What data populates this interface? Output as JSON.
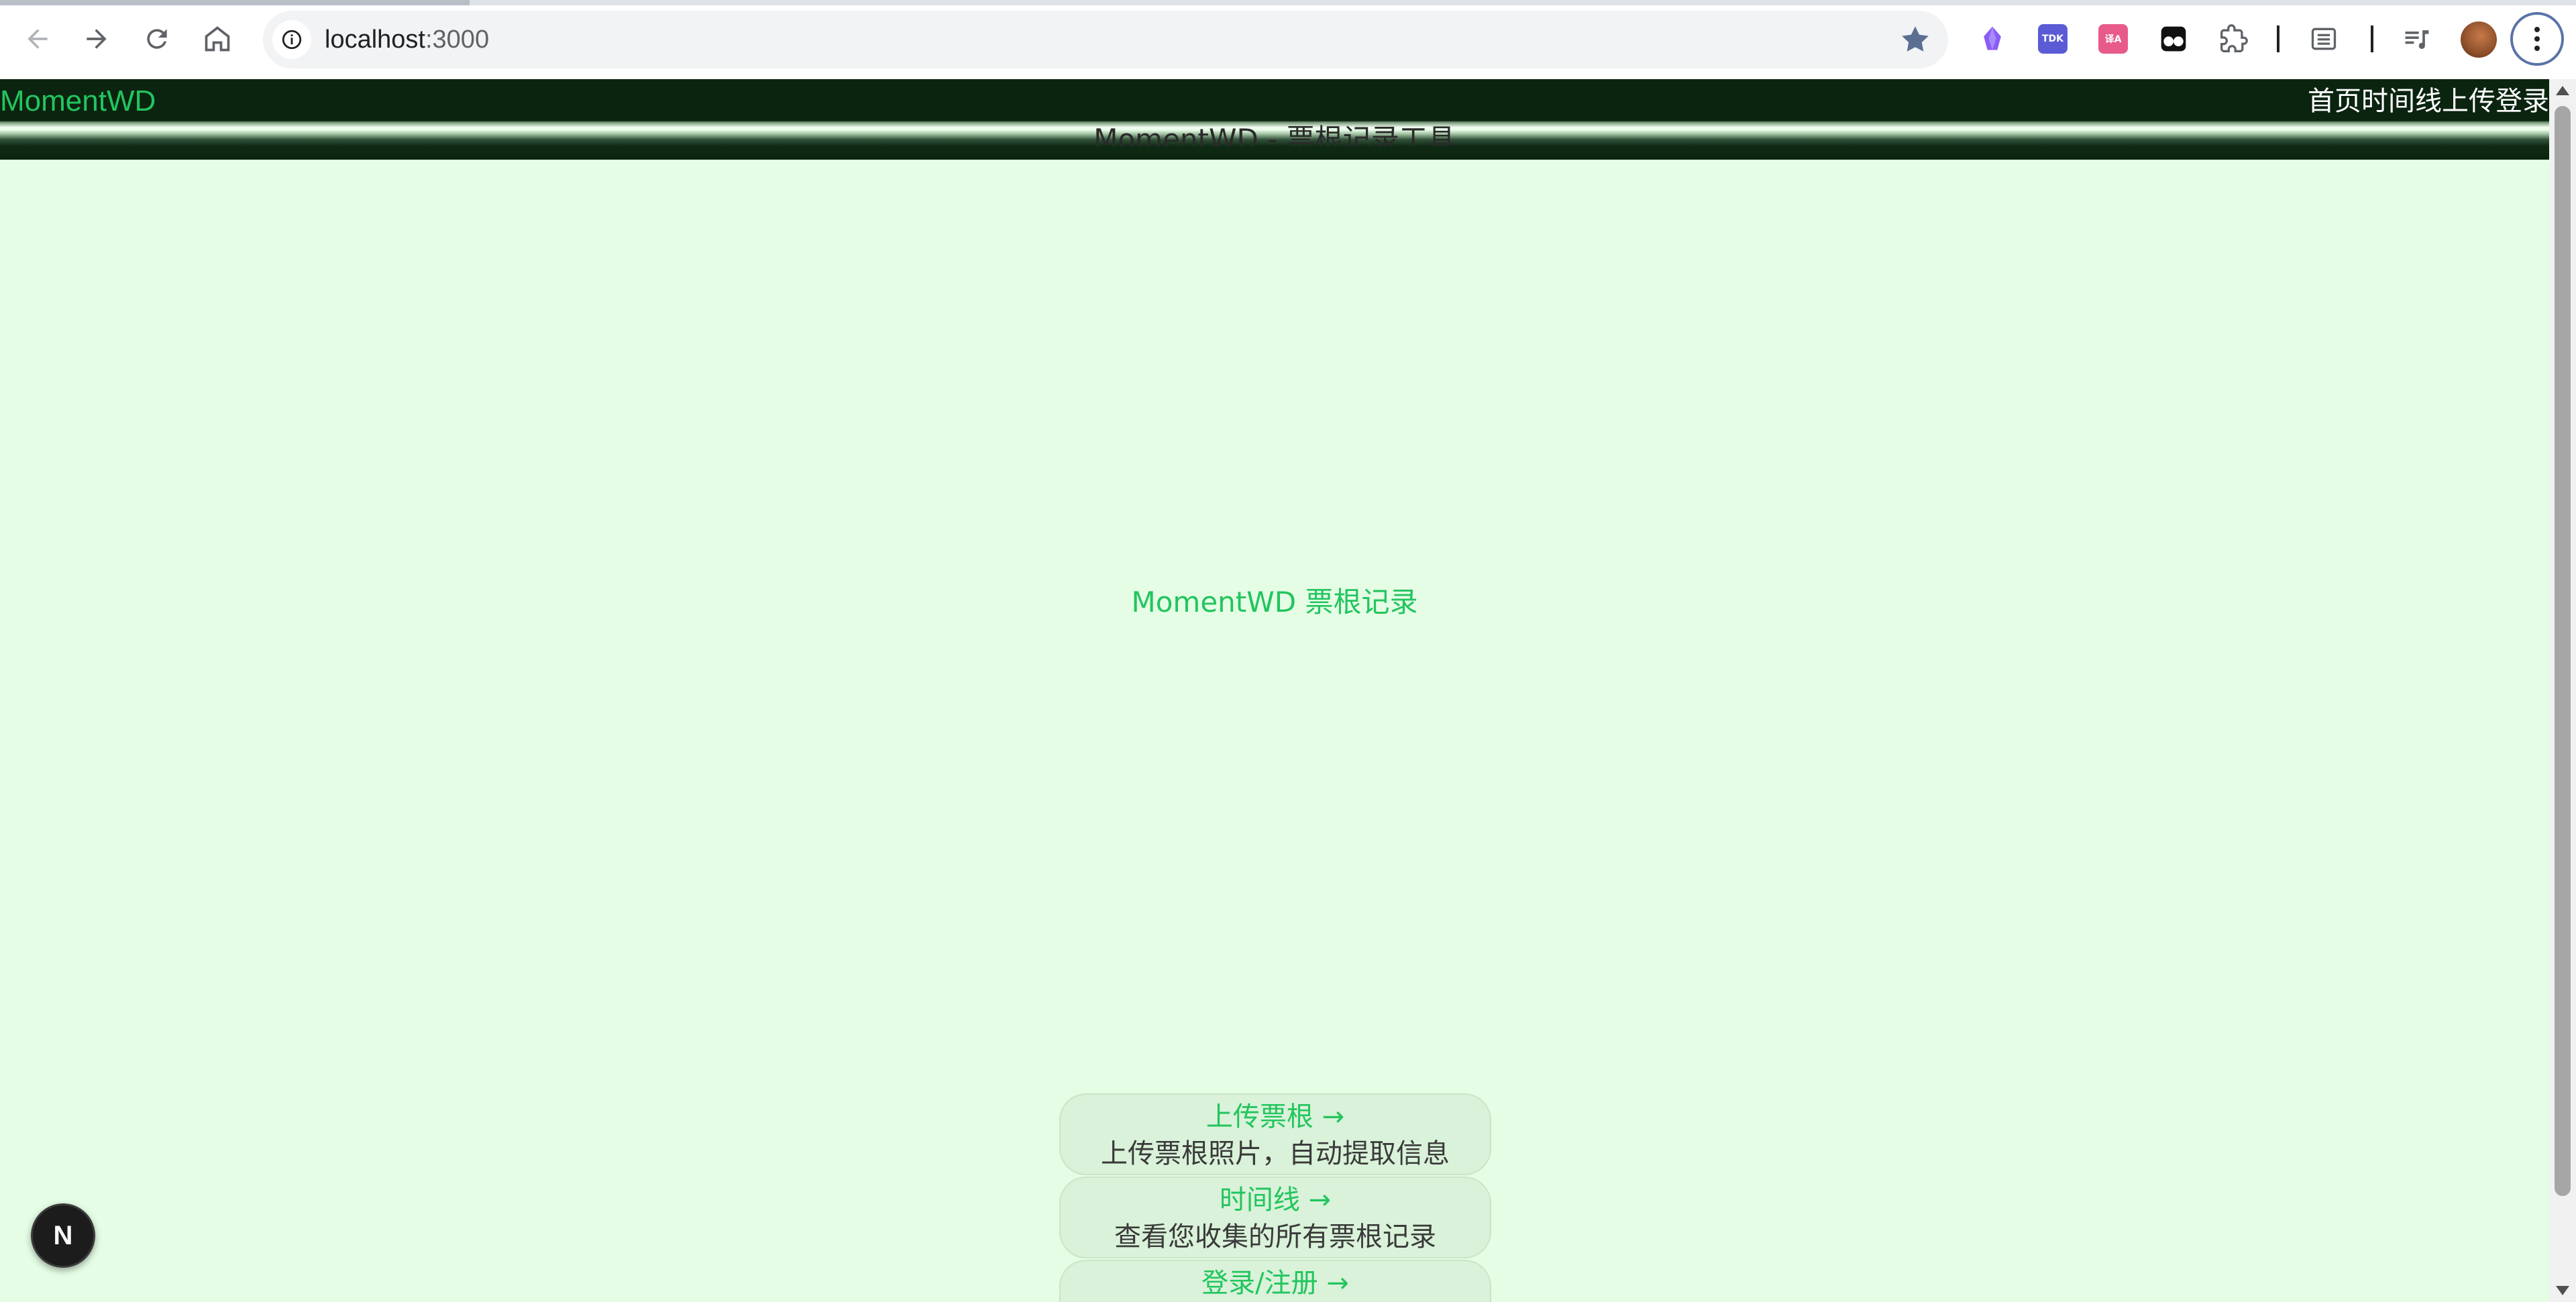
{
  "browser": {
    "url_host": "localhost",
    "url_port": ":3000",
    "extensions": [
      {
        "name": "obsidian-clipper-icon",
        "label": "",
        "color": "#8b5cf6"
      },
      {
        "name": "tdk-extension-icon",
        "label": "TDK",
        "color": "#6366f1"
      },
      {
        "name": "translate-extension-icon",
        "label": "译A",
        "color": "#ec4899"
      },
      {
        "name": "tampermonkey-icon",
        "label": "",
        "color": "#111111"
      }
    ]
  },
  "header": {
    "brand": "MomentWD",
    "subtitle": "MomentWD - 票根记录工具",
    "nav": [
      "首页",
      "时间线",
      "上传",
      "登录"
    ]
  },
  "hero": {
    "title": "MomentWD 票根记录"
  },
  "cards": [
    {
      "title": "上传票根 →",
      "desc": "上传票根照片，自动提取信息"
    },
    {
      "title": "时间线 →",
      "desc": "查看您收集的所有票根记录"
    },
    {
      "title": "登录/注册 →",
      "desc": ""
    }
  ],
  "dev_badge": {
    "label": "N"
  },
  "colors": {
    "accent": "#22c55e",
    "header_bg": "#0b2410",
    "page_bg": "#e5fde5"
  }
}
